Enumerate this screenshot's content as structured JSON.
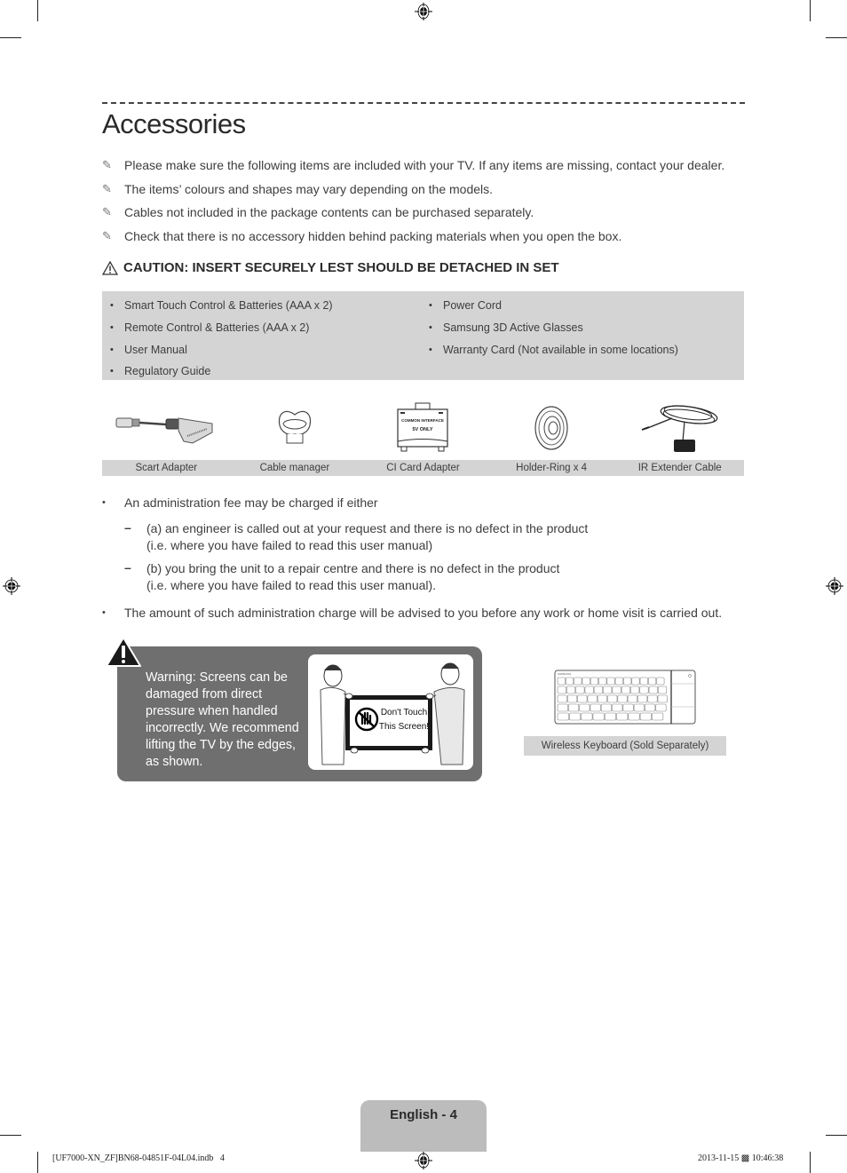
{
  "page": {
    "title": "Accessories",
    "notes": [
      {
        "icon": "pencil-note-icon",
        "text": "Please make sure the following items are included with your TV. If any items are missing, contact your dealer."
      },
      {
        "icon": "pencil-note-icon",
        "text": "The items’ colours and shapes may vary depending on the models."
      },
      {
        "icon": "pencil-note-icon",
        "text": "Cables not included in the package contents can be purchased separately."
      },
      {
        "icon": "pencil-note-icon",
        "text": "Check that there is no accessory hidden behind packing materials when you open the box."
      }
    ],
    "caution": {
      "icon": "warning-triangle-icon",
      "text": "CAUTION: INSERT SECURELY LEST SHOULD BE DETACHED IN SET"
    },
    "included_items": {
      "left": [
        "Smart Touch Control & Batteries (AAA x 2)",
        "Remote Control & Batteries (AAA x 2)",
        "User Manual",
        "Regulatory Guide"
      ],
      "right": [
        "Power Cord",
        "Samsung 3D Active Glasses",
        "Warranty Card (Not available in some locations)"
      ]
    },
    "accessories": [
      {
        "label": "Scart Adapter",
        "icon": "scart-adapter-image"
      },
      {
        "label": "Cable manager",
        "icon": "cable-manager-image"
      },
      {
        "label": "CI Card Adapter",
        "icon": "ci-card-adapter-image",
        "printed": [
          "COMMON INTERFACE",
          "5V ONLY"
        ]
      },
      {
        "label": "Holder-Ring x 4",
        "icon": "holder-ring-image"
      },
      {
        "label": "IR Extender Cable",
        "icon": "ir-extender-cable-image"
      }
    ],
    "fees": {
      "bullet1": "An administration fee may be charged if either",
      "sub_a": [
        "(a) an engineer is called out at your request and there is no defect in the product",
        "(i.e. where you have failed to read this user manual)"
      ],
      "sub_b": [
        "(b) you bring the unit to a repair centre and there is no defect in the product",
        "(i.e. where you have failed to read this user manual)."
      ],
      "bullet2": "The amount of such administration charge will be advised to you before any work or home visit is carried out."
    },
    "warning": {
      "label": "Warning",
      "text": ": Screens can be damaged from direct pressure when handled incorrectly. We recommend lifting the TV by the edges, as shown.",
      "sign_line1": "Don't Touch",
      "sign_line2": "This Screen!"
    },
    "keyboard": {
      "label": "Wireless Keyboard (Sold Separately)"
    },
    "footer": {
      "page_label": "English - 4",
      "slug_left": "[UF7000-XN_ZF]BN68-04851F-04L04.indb   4",
      "slug_date": "2013-11-15",
      "slug_glyph": "▩",
      "slug_time": "10:46:38"
    }
  }
}
